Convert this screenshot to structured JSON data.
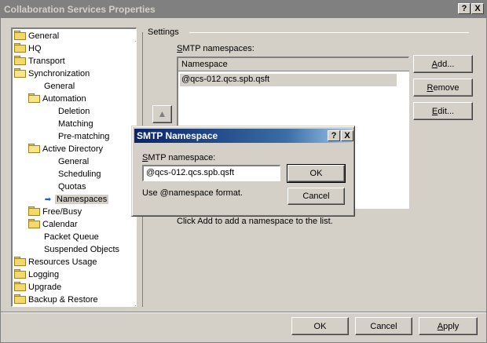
{
  "window": {
    "title": "Collaboration Services Properties",
    "help_btn": "?",
    "close_btn": "X"
  },
  "tree": {
    "items": [
      {
        "label": "General"
      },
      {
        "label": "HQ"
      },
      {
        "label": "Transport"
      },
      {
        "label": "Synchronization"
      },
      {
        "label": "General"
      },
      {
        "label": "Automation"
      },
      {
        "label": "Deletion"
      },
      {
        "label": "Matching"
      },
      {
        "label": "Pre-matching"
      },
      {
        "label": "Active Directory"
      },
      {
        "label": "General"
      },
      {
        "label": "Scheduling"
      },
      {
        "label": "Quotas"
      },
      {
        "label": "Namespaces"
      },
      {
        "label": "Free/Busy"
      },
      {
        "label": "Calendar"
      },
      {
        "label": "Packet Queue"
      },
      {
        "label": "Suspended Objects"
      },
      {
        "label": "Resources Usage"
      },
      {
        "label": "Logging"
      },
      {
        "label": "Upgrade"
      },
      {
        "label": "Backup & Restore"
      }
    ],
    "selected": "Namespaces"
  },
  "settings": {
    "group_label": "Settings",
    "list_label_prefix": "S",
    "list_label_rest": "MTP namespaces:",
    "column_header": "Namespace",
    "rows": [
      "@qcs-012.qcs.spb.qsft"
    ],
    "add_prefix": "A",
    "add_rest": "dd...",
    "remove_prefix": "R",
    "remove_rest": "emove",
    "edit_prefix": "E",
    "edit_rest": "dit...",
    "hint": "Click Add to add a namespace to the list."
  },
  "footer": {
    "ok": "OK",
    "cancel": "Cancel",
    "apply_prefix": "A",
    "apply_rest": "pply"
  },
  "dialog": {
    "title": "SMTP Namespace",
    "help_btn": "?",
    "close_btn": "X",
    "field_label_prefix": "S",
    "field_label_rest": "MTP namespace:",
    "field_value": "@qcs-012.qcs.spb.qsft",
    "ok": "OK",
    "cancel": "Cancel",
    "note": "Use @namespace format."
  }
}
